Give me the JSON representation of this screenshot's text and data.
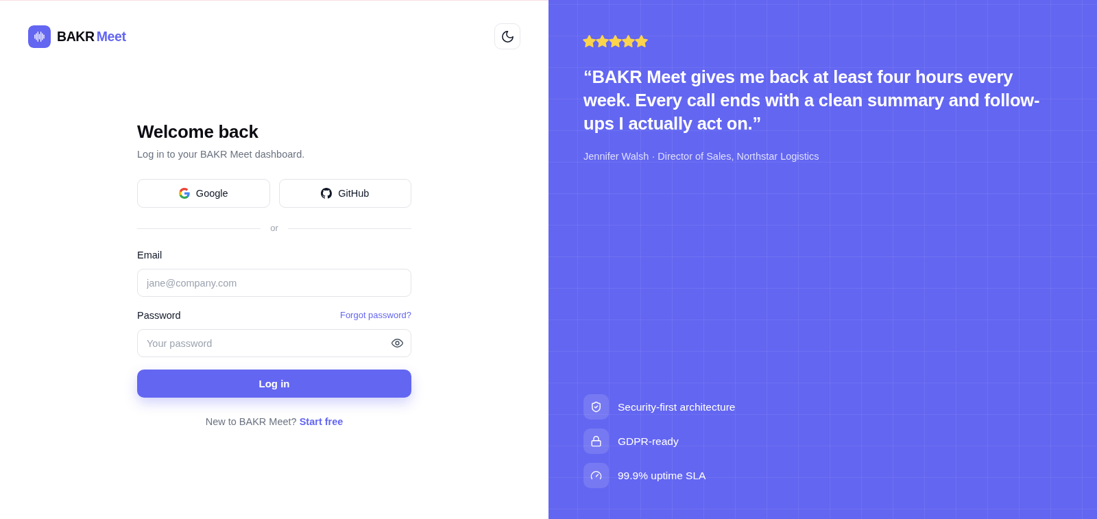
{
  "brand": {
    "name": "BAKR",
    "accent": "Meet"
  },
  "login": {
    "title": "Welcome back",
    "subtitle": "Log in to your BAKR Meet dashboard.",
    "social_buttons": [
      {
        "kind": "google",
        "label": "Google"
      },
      {
        "kind": "github",
        "label": "GitHub"
      }
    ],
    "divider": "or",
    "fields": [
      {
        "kind": "email",
        "label": "Email",
        "placeholder": "jane@company.com"
      },
      {
        "kind": "password",
        "label": "Password",
        "link": "Forgot password?",
        "placeholder": "Your password"
      }
    ],
    "submit": "Log in",
    "signup": {
      "prompt": "New to BAKR Meet?",
      "link": "Start free"
    }
  },
  "testimonial": {
    "stars": 5,
    "quote": "“BAKR Meet gives me back at least four hours every week. Every call ends with a clean summary and follow-ups I actually act on.”",
    "author": "Jennifer Walsh · Director of Sales, Northstar Logistics"
  },
  "features": [
    {
      "kind": "shield",
      "label": "Security-first architecture"
    },
    {
      "kind": "lock",
      "label": "GDPR-ready"
    },
    {
      "kind": "gauge",
      "label": "99.9% uptime SLA"
    }
  ]
}
